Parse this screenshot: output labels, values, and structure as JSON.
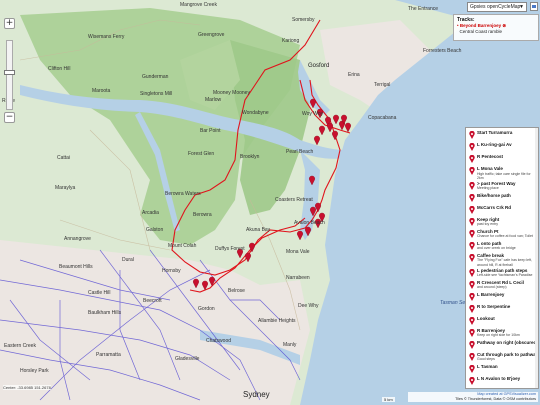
{
  "map": {
    "layer_select": "Gpsies openCycleMap",
    "zoom_in": "+",
    "zoom_out": "−",
    "place_labels": [
      {
        "name": "Mangrove Creek",
        "kind": "town"
      },
      {
        "name": "Somersby",
        "kind": "town"
      },
      {
        "name": "The Entrance",
        "kind": "town"
      },
      {
        "name": "Wisemans Ferry",
        "kind": "town"
      },
      {
        "name": "Greengrove",
        "kind": "town"
      },
      {
        "name": "Kariong",
        "kind": "town"
      },
      {
        "name": "Forresters Beach",
        "kind": "town"
      },
      {
        "name": "Gosford",
        "kind": "town"
      },
      {
        "name": "Clifton Hill",
        "kind": "town"
      },
      {
        "name": "Gunderman",
        "kind": "town"
      },
      {
        "name": "Erina",
        "kind": "town"
      },
      {
        "name": "Maroota",
        "kind": "town"
      },
      {
        "name": "Singletons Mill",
        "kind": "town"
      },
      {
        "name": "Mooney Mooney",
        "kind": "town"
      },
      {
        "name": "Terrigal",
        "kind": "town"
      },
      {
        "name": "Ridge",
        "kind": "town"
      },
      {
        "name": "Marlow",
        "kind": "town"
      },
      {
        "name": "Woy Woy",
        "kind": "town"
      },
      {
        "name": "Wondabyne",
        "kind": "town"
      },
      {
        "name": "Copacabana",
        "kind": "town"
      },
      {
        "name": "Bar Point",
        "kind": "town"
      },
      {
        "name": "Brooklyn",
        "kind": "town"
      },
      {
        "name": "Pearl Beach",
        "kind": "town"
      },
      {
        "name": "Forest Glen",
        "kind": "town"
      },
      {
        "name": "Cattai",
        "kind": "town"
      },
      {
        "name": "Maraylya",
        "kind": "town"
      },
      {
        "name": "Berowra Waters",
        "kind": "town"
      },
      {
        "name": "Coasters Retreat",
        "kind": "town"
      },
      {
        "name": "Arcadia",
        "kind": "town"
      },
      {
        "name": "Berowra",
        "kind": "town"
      },
      {
        "name": "Annangrove",
        "kind": "town"
      },
      {
        "name": "Galston",
        "kind": "town"
      },
      {
        "name": "Akuna Bay",
        "kind": "town"
      },
      {
        "name": "Avalon Beach",
        "kind": "town"
      },
      {
        "name": "Mount Colah",
        "kind": "town"
      },
      {
        "name": "Duffys Forest",
        "kind": "town"
      },
      {
        "name": "Dural",
        "kind": "town"
      },
      {
        "name": "Mona Vale",
        "kind": "town"
      },
      {
        "name": "Hornsby",
        "kind": "town"
      },
      {
        "name": "Belrose",
        "kind": "town"
      },
      {
        "name": "Narrabeen",
        "kind": "town"
      },
      {
        "name": "Beaumont Hills",
        "kind": "town"
      },
      {
        "name": "Castle Hill",
        "kind": "town"
      },
      {
        "name": "Beecroft",
        "kind": "town"
      },
      {
        "name": "Baulkham Hills",
        "kind": "town"
      },
      {
        "name": "Gordon",
        "kind": "town"
      },
      {
        "name": "Dee Why",
        "kind": "town"
      },
      {
        "name": "Allambie Heights",
        "kind": "town"
      },
      {
        "name": "Eastern Creek",
        "kind": "town"
      },
      {
        "name": "Chatswood",
        "kind": "town"
      },
      {
        "name": "Manly",
        "kind": "town"
      },
      {
        "name": "Parramatta",
        "kind": "town"
      },
      {
        "name": "Gladesville",
        "kind": "town"
      },
      {
        "name": "Horsley Park",
        "kind": "town"
      },
      {
        "name": "Sydney",
        "kind": "city"
      },
      {
        "name": "Tasman Sea",
        "kind": "water"
      }
    ]
  },
  "tracks": {
    "title": "Tracks:",
    "items": [
      {
        "label": "Beyond Barrenjoey",
        "active": true
      },
      {
        "label": "Central Coast ramble",
        "active": false
      }
    ]
  },
  "waypoints": [
    {
      "title": "Start Turramurra",
      "note": ""
    },
    {
      "title": "L Ku-ring-gai Av",
      "note": ""
    },
    {
      "title": "R Pentecost",
      "note": ""
    },
    {
      "title": "L Mona Vale",
      "note": "High traffic; take care single file for 2km"
    },
    {
      "title": "> past Forest Way",
      "note": "Meeting place"
    },
    {
      "title": "Bike/horse path",
      "note": ""
    },
    {
      "title": "McCarrs Crk Rd",
      "note": ""
    },
    {
      "title": "Keep right",
      "note": "past toy entry"
    },
    {
      "title": "Church Pt",
      "note": "Chance for coffee at food van; Toilet"
    },
    {
      "title": "L onto path",
      "note": "and over creek on bridge"
    },
    {
      "title": "Caffee break",
      "note": "The \"Flying Fox\" cafe has keep left, around hill, R at fireball"
    },
    {
      "title": "L pedestrian path steps",
      "note": "Left-side see Yachtsman's Paradise"
    },
    {
      "title": "R Crescent Rd L Cecil",
      "note": "and around (steep)"
    },
    {
      "title": "L Barrenjoey",
      "note": ""
    },
    {
      "title": "R to Serpentine",
      "note": ""
    },
    {
      "title": "Lookout",
      "note": ""
    },
    {
      "title": "R Barrenjoey",
      "note": "Keep on right side for 10km"
    },
    {
      "title": "Pathway on right (obscured)",
      "note": ""
    },
    {
      "title": "Cut through park to pathway",
      "note": "Good steps"
    },
    {
      "title": "L Tasman",
      "note": ""
    },
    {
      "title": "L N Avalon to B'joey",
      "note": ""
    }
  ],
  "status": {
    "coords": "Center: -33.6985 151.2678",
    "scale": "5 km",
    "attribution_line1": "Map created at GPSVisualizer.com",
    "attribution_line2": "Tiles © Thunderforest, Data © OSM contributors"
  },
  "colors": {
    "track": "#e0141c",
    "water": "#b5d0e6",
    "land": "#dce9d3",
    "forest": "#a9cf93",
    "urban": "#ece6e2",
    "cycle_routes": "#4a3fd1",
    "pin": "#c8102e"
  }
}
